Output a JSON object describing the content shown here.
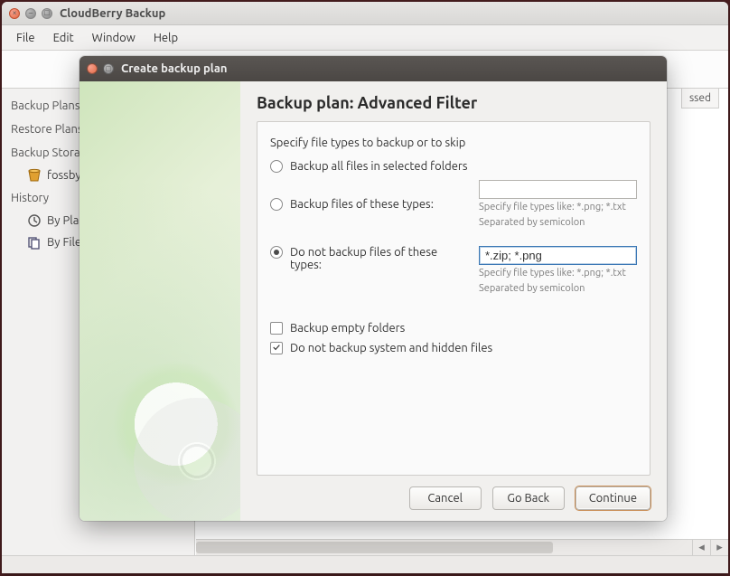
{
  "main": {
    "title": "CloudBerry Backup",
    "menu": [
      "File",
      "Edit",
      "Window",
      "Help"
    ]
  },
  "sidebar": {
    "heads": {
      "backup_plans": "Backup Plans",
      "restore_plans": "Restore Plans",
      "backup_storage": "Backup Storage",
      "history": "History"
    },
    "storage_item": "fossbyt",
    "history_items": {
      "by_plan": "By Plan",
      "by_files": "By Files"
    }
  },
  "main_pane": {
    "column": "ssed"
  },
  "dialog": {
    "title": "Create backup plan",
    "heading": "Backup plan: Advanced Filter",
    "lead": "Specify file types to backup or to skip",
    "options": {
      "all": "Backup all files in selected folders",
      "include": "Backup files of these types:",
      "exclude": "Do not backup files of these types:"
    },
    "include_value": "",
    "exclude_value": "*.zip; *.png",
    "hint_line1": "Specify file types like: *.png; *.txt",
    "hint_line2": "Separated by semicolon",
    "checks": {
      "empty": "Backup empty folders",
      "system": "Do not backup system and hidden files"
    },
    "buttons": {
      "cancel": "Cancel",
      "back": "Go Back",
      "next": "Continue"
    }
  }
}
